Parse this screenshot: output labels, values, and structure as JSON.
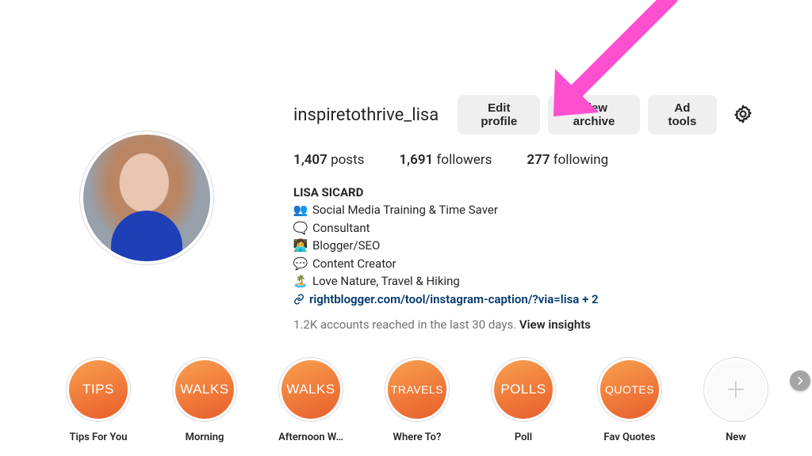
{
  "profile": {
    "username": "inspiretothrive_lisa",
    "buttons": {
      "edit": "Edit profile",
      "archive": "View archive",
      "adtools": "Ad tools"
    },
    "stats": {
      "posts_count": "1,407",
      "posts_label": "posts",
      "followers_count": "1,691",
      "followers_label": "followers",
      "following_count": "277",
      "following_label": "following"
    },
    "bio": {
      "name": "LISA SICARD",
      "lines": [
        {
          "emoji": "👥",
          "text": "Social Media Training & Time Saver"
        },
        {
          "emoji": "🗨️",
          "text": "Consultant"
        },
        {
          "emoji": "👩‍💻",
          "text": "Blogger/SEO"
        },
        {
          "emoji": "💬",
          "text": "Content Creator"
        },
        {
          "emoji": "🏝️",
          "text": "Love Nature, Travel & Hiking"
        }
      ],
      "link_text": "rightblogger.com/tool/instagram-caption/?via=lisa + 2"
    },
    "insights": {
      "text": "1.2K accounts reached in the last 30 days.",
      "cta": "View insights"
    }
  },
  "highlights": [
    {
      "cover": "TIPS",
      "label": "Tips For You"
    },
    {
      "cover": "WALKS",
      "label": "Morning"
    },
    {
      "cover": "WALKS",
      "label": "Afternoon W…"
    },
    {
      "cover": "TRAVELS",
      "label": "Where To?"
    },
    {
      "cover": "POLLS",
      "label": "Poll"
    },
    {
      "cover": "QUOTES",
      "label": "Fav Quotes"
    }
  ],
  "new_highlight_label": "New",
  "annotation": {
    "color": "#ff4fd1"
  }
}
